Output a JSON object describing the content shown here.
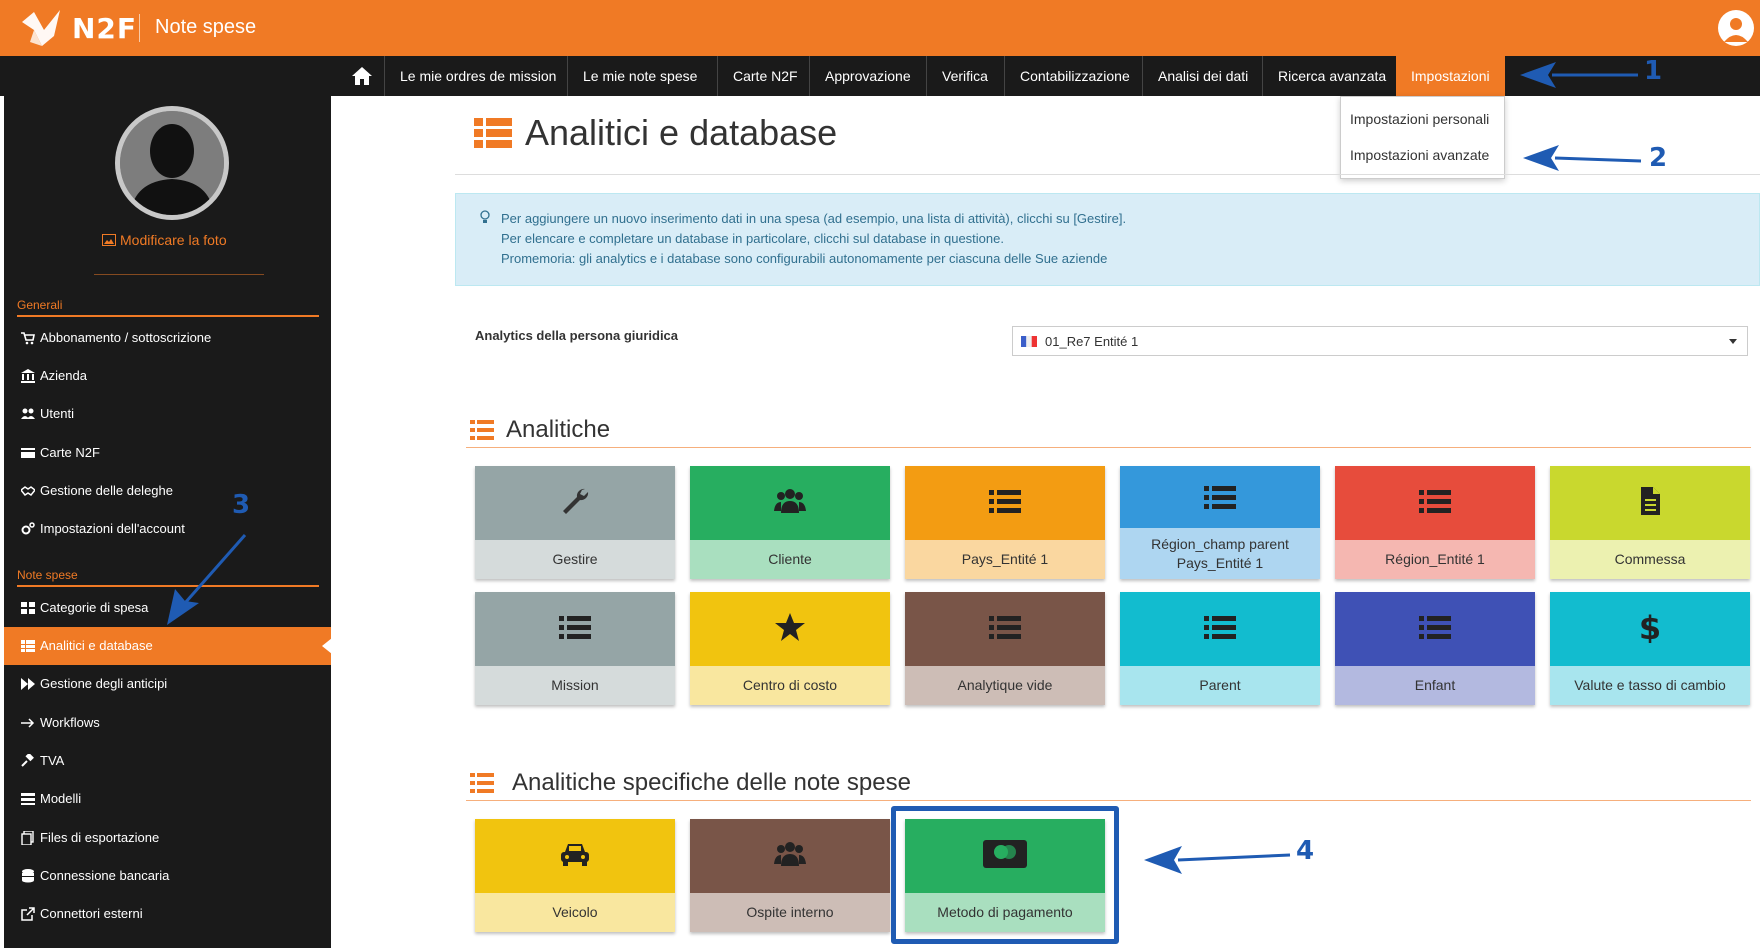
{
  "app": {
    "logo_text": "N2F",
    "title": "Note spese"
  },
  "nav": {
    "home_icon": "home-icon",
    "items": [
      {
        "label": "Le mie ordres de mission"
      },
      {
        "label": "Le mie note spese"
      },
      {
        "label": "Carte N2F"
      },
      {
        "label": "Approvazione"
      },
      {
        "label": "Verifica"
      },
      {
        "label": "Contabilizzazione"
      },
      {
        "label": "Analisi dei dati"
      },
      {
        "label": "Ricerca avanzata"
      },
      {
        "label": "Impostazioni",
        "active": true
      }
    ]
  },
  "dropdown": {
    "items": [
      "Impostazioni personali",
      "Impostazioni avanzate"
    ]
  },
  "sidebar": {
    "modify_photo": "Modificare la foto",
    "section_general": "Generali",
    "general_items": [
      {
        "label": "Abbonamento / sottoscrizione",
        "icon": "cart-icon"
      },
      {
        "label": "Azienda",
        "icon": "bank-icon"
      },
      {
        "label": "Utenti",
        "icon": "users-icon"
      },
      {
        "label": "Carte N2F",
        "icon": "card-icon"
      },
      {
        "label": "Gestione delle deleghe",
        "icon": "handshake-icon"
      },
      {
        "label": "Impostazioni dell'account",
        "icon": "gears-icon"
      }
    ],
    "section_expenses": "Note spese",
    "expense_items": [
      {
        "label": "Categorie di spesa",
        "icon": "grid-icon"
      },
      {
        "label": "Analitici e database",
        "icon": "table-icon",
        "active": true
      },
      {
        "label": "Gestione degli anticipi",
        "icon": "fast-forward-icon"
      },
      {
        "label": "Workflows",
        "icon": "arrow-right-icon"
      },
      {
        "label": "TVA",
        "icon": "gavel-icon"
      },
      {
        "label": "Modelli",
        "icon": "list-icon"
      },
      {
        "label": "Files di esportazione",
        "icon": "files-icon"
      },
      {
        "label": "Connessione bancaria",
        "icon": "database-icon"
      },
      {
        "label": "Connettori esterni",
        "icon": "external-link-icon"
      }
    ]
  },
  "main": {
    "title": "Analitici e database",
    "info_lines": [
      "Per aggiungere un nuovo inserimento dati in una spesa (ad esempio, una lista di attività), clicchi su [Gestire].",
      "Per elencare e completare un database in particolare, clicchi sul database in questione.",
      "Promemoria: gli analytics e i database sono configurabili autonomamente per ciascuna delle Sue aziende"
    ],
    "entity_label": "Analytics della persona giuridica",
    "entity_value": "01_Re7 Entité 1",
    "section_analytics": "Analitiche",
    "analytics_tiles": [
      {
        "label": "Gestire",
        "icon": "wrench-icon",
        "top": "#95a5a6",
        "bottom": "#d5dbdb"
      },
      {
        "label": "Cliente",
        "icon": "users-icon",
        "top": "#27ae60",
        "bottom": "#a9dfbf"
      },
      {
        "label": "Pays_Entité 1",
        "icon": "list-icon",
        "top": "#f39c12",
        "bottom": "#fad7a0"
      },
      {
        "label": "Région_champ parent\nPays_Entité 1",
        "icon": "list-icon",
        "top": "#3498db",
        "bottom": "#aed6f1"
      },
      {
        "label": "Région_Entité 1",
        "icon": "list-icon",
        "top": "#e74c3c",
        "bottom": "#f5b7b1"
      },
      {
        "label": "Commessa",
        "icon": "file-icon",
        "top": "#c9d82e",
        "bottom": "#ecf1b0"
      },
      {
        "label": "Mission",
        "icon": "list-icon",
        "top": "#95a5a6",
        "bottom": "#d5dbdb"
      },
      {
        "label": "Centro di costo",
        "icon": "star-icon",
        "top": "#f1c40f",
        "bottom": "#f9e79f"
      },
      {
        "label": "Analytique vide",
        "icon": "list-icon",
        "top": "#795548",
        "bottom": "#cdbdb6"
      },
      {
        "label": "Parent",
        "icon": "list-icon",
        "top": "#1abc9c",
        "bottom": "#a3e4d7",
        "alt_top": "#12bccf",
        "alt_bottom": "#a8e5ee"
      },
      {
        "label": "Enfant",
        "icon": "list-icon",
        "top": "#3f51b5",
        "bottom": "#b3b9e0"
      },
      {
        "label": "Valute e tasso di cambio",
        "icon": "dollar-icon",
        "top": "#1abc9c",
        "bottom": "#a3e4d7",
        "alt_top": "#12bccf",
        "alt_bottom": "#a8e5ee"
      }
    ],
    "section_specific": "Analitiche specifiche delle note spese",
    "specific_tiles": [
      {
        "label": "Veicolo",
        "icon": "car-icon",
        "top": "#f1c40f",
        "bottom": "#f9e79f"
      },
      {
        "label": "Ospite interno",
        "icon": "users-icon",
        "top": "#795548",
        "bottom": "#cdbdb6"
      },
      {
        "label": "Metodo di pagamento",
        "icon": "mastercard-icon",
        "top": "#27ae60",
        "bottom": "#a9dfbf"
      }
    ]
  },
  "annotations": [
    "1",
    "2",
    "3",
    "4"
  ],
  "colors": {
    "accent": "#f07a25",
    "dark": "#1a1a1a",
    "annotation": "#1f5bb3"
  }
}
